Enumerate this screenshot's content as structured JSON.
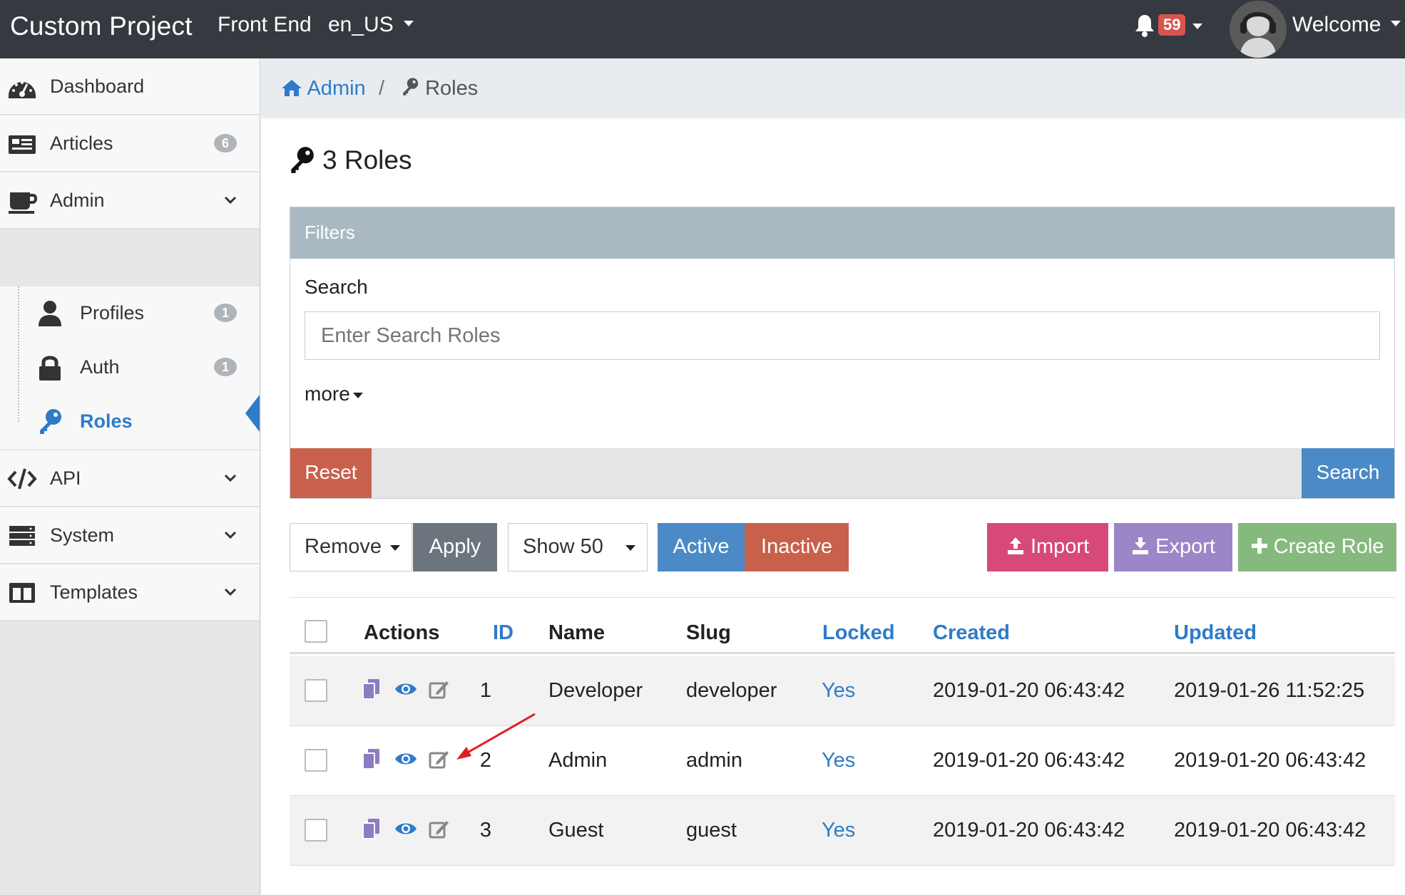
{
  "navbar": {
    "brand": "Custom Project",
    "front_end": "Front End",
    "locale": "en_US",
    "notifications": "59",
    "welcome": "Welcome"
  },
  "sidebar": {
    "items": [
      {
        "label": "Dashboard",
        "icon": "tachometer-icon"
      },
      {
        "label": "Articles",
        "badge": "6",
        "icon": "newspaper-icon"
      },
      {
        "label": "Admin",
        "icon": "coffee-icon"
      },
      {
        "label": "API",
        "icon": "code-icon"
      },
      {
        "label": "System",
        "icon": "server-icon"
      },
      {
        "label": "Templates",
        "icon": "columns-icon"
      }
    ],
    "admin_children": [
      {
        "label": "Profiles",
        "badge": "1",
        "icon": "user-icon"
      },
      {
        "label": "Auth",
        "badge": "1",
        "icon": "lock-icon"
      },
      {
        "label": "Roles",
        "icon": "key-icon",
        "active": true
      }
    ]
  },
  "breadcrumb": {
    "home": "Admin",
    "separator": "/",
    "current": "Roles"
  },
  "page": {
    "title": "3 Roles"
  },
  "filters": {
    "heading": "Filters",
    "search_label": "Search",
    "search_placeholder": "Enter Search Roles",
    "more": "more",
    "reset": "Reset",
    "search_button": "Search"
  },
  "toolbar": {
    "bulk_action": "Remove",
    "apply": "Apply",
    "show": "Show 50",
    "active": "Active",
    "inactive": "Inactive",
    "import": "Import",
    "export": "Export",
    "create": "Create Role"
  },
  "table": {
    "headers": {
      "actions": "Actions",
      "id": "ID",
      "name": "Name",
      "slug": "Slug",
      "locked": "Locked",
      "created": "Created",
      "updated": "Updated"
    },
    "rows": [
      {
        "id": "1",
        "name": "Developer",
        "slug": "developer",
        "locked": "Yes",
        "created": "2019-01-20 06:43:42",
        "updated": "2019-01-26 11:52:25"
      },
      {
        "id": "2",
        "name": "Admin",
        "slug": "admin",
        "locked": "Yes",
        "created": "2019-01-20 06:43:42",
        "updated": "2019-01-20 06:43:42"
      },
      {
        "id": "3",
        "name": "Guest",
        "slug": "guest",
        "locked": "Yes",
        "created": "2019-01-20 06:43:42",
        "updated": "2019-01-20 06:43:42"
      }
    ]
  },
  "colors": {
    "navbar": "#343a40",
    "link": "#2f7bc9",
    "reset": "#c9604b",
    "search": "#4b8ac6",
    "apply": "#6c757d",
    "active": "#4b8ac6",
    "inactive": "#c9604b",
    "import": "#d6497a",
    "export": "#9b86c8",
    "create": "#86b97e",
    "annotation_arrow": "#e21d1d"
  }
}
